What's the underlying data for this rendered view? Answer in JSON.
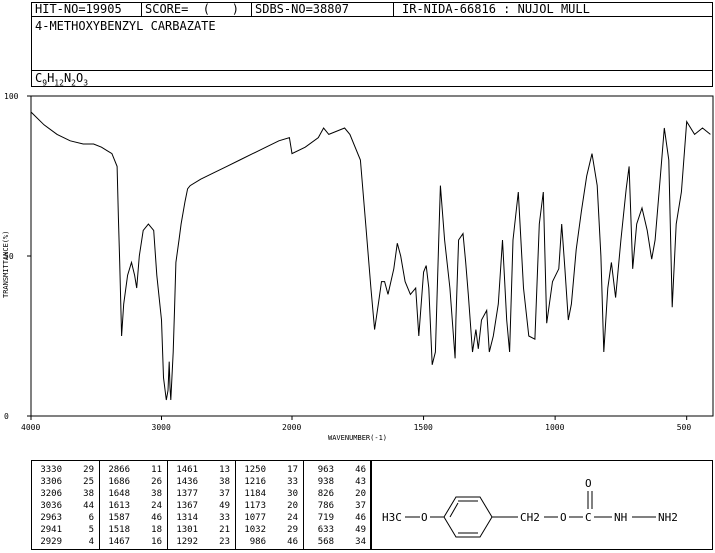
{
  "header": {
    "hit_no": "HIT-NO=19905",
    "score": "SCORE=  (   )",
    "sdbs_no": "SDBS-NO=38807",
    "ir_info": "IR-NIDA-66816 : NUJOL MULL",
    "compound_name": "4-METHOXYBENZYL CARBAZATE",
    "formula": {
      "c": "C",
      "c_n": "9",
      "h": "H",
      "h_n": "12",
      "n": "N",
      "n_n": "2",
      "o": "O",
      "o_n": "3"
    }
  },
  "chart_data": {
    "type": "line",
    "title": "",
    "xlabel": "WAVENUMBER(-1)",
    "ylabel": "TRANSMITTANCE(%)",
    "xlim": [
      4000,
      400
    ],
    "ylim": [
      0,
      100
    ],
    "x_reversed": true,
    "x_ticks": [
      4000,
      3000,
      2000,
      1500,
      1000,
      500
    ],
    "y_ticks": [
      0,
      50,
      100
    ],
    "grid": false,
    "legend": "none",
    "series": [
      {
        "x": [
          4000,
          3900,
          3800,
          3700,
          3600,
          3520,
          3460,
          3420,
          3380,
          3340,
          3330,
          3320,
          3306,
          3290,
          3260,
          3230,
          3206,
          3190,
          3170,
          3140,
          3100,
          3060,
          3036,
          3000,
          2985,
          2963,
          2950,
          2941,
          2935,
          2929,
          2910,
          2900,
          2890,
          2866,
          2850,
          2820,
          2800,
          2780,
          2700,
          2600,
          2500,
          2400,
          2300,
          2200,
          2100,
          2020,
          2000,
          1950,
          1900,
          1880,
          1860,
          1800,
          1780,
          1740,
          1720,
          1700,
          1686,
          1670,
          1660,
          1648,
          1635,
          1613,
          1600,
          1587,
          1570,
          1550,
          1530,
          1518,
          1500,
          1490,
          1480,
          1467,
          1455,
          1440,
          1436,
          1420,
          1400,
          1380,
          1377,
          1367,
          1350,
          1340,
          1330,
          1314,
          1301,
          1292,
          1280,
          1260,
          1250,
          1235,
          1216,
          1200,
          1184,
          1173,
          1160,
          1140,
          1120,
          1100,
          1077,
          1060,
          1045,
          1032,
          1010,
          986,
          975,
          963,
          950,
          938,
          920,
          900,
          880,
          860,
          840,
          826,
          815,
          800,
          786,
          770,
          750,
          730,
          719,
          705,
          690,
          670,
          650,
          633,
          620,
          600,
          585,
          568,
          555,
          540,
          520,
          500,
          470,
          440,
          410
        ],
        "y": [
          95,
          91,
          88,
          86,
          85,
          85,
          84,
          83,
          82,
          78,
          62,
          48,
          25,
          35,
          44,
          48,
          44,
          40,
          50,
          58,
          60,
          58,
          44,
          30,
          12,
          5,
          8,
          17,
          9,
          5,
          20,
          34,
          48,
          55,
          60,
          67,
          71,
          72,
          74,
          76,
          78,
          80,
          82,
          84,
          86,
          87,
          82,
          84,
          87,
          90,
          88,
          90,
          88,
          80,
          60,
          40,
          27,
          36,
          42,
          42,
          38,
          46,
          54,
          50,
          42,
          38,
          40,
          25,
          45,
          47,
          40,
          16,
          20,
          62,
          72,
          55,
          40,
          18,
          30,
          55,
          57,
          48,
          38,
          20,
          27,
          21,
          30,
          33,
          20,
          25,
          35,
          55,
          30,
          20,
          55,
          70,
          40,
          25,
          24,
          60,
          70,
          29,
          42,
          46,
          60,
          46,
          30,
          35,
          52,
          64,
          75,
          82,
          72,
          50,
          20,
          40,
          48,
          37,
          55,
          71,
          78,
          46,
          60,
          65,
          58,
          49,
          55,
          75,
          90,
          80,
          34,
          60,
          70,
          92,
          88,
          90,
          88
        ]
      }
    ]
  },
  "peaks": {
    "columns": [
      [
        [
          "3330",
          "29"
        ],
        [
          "3306",
          "25"
        ],
        [
          "3206",
          "38"
        ],
        [
          "3036",
          "44"
        ],
        [
          "2963",
          "6"
        ],
        [
          "2941",
          "5"
        ],
        [
          "2929",
          "4"
        ]
      ],
      [
        [
          "2866",
          "11"
        ],
        [
          "1686",
          "26"
        ],
        [
          "1648",
          "38"
        ],
        [
          "1613",
          "24"
        ],
        [
          "1587",
          "46"
        ],
        [
          "1518",
          "18"
        ],
        [
          "1467",
          "16"
        ]
      ],
      [
        [
          "1461",
          "13"
        ],
        [
          "1436",
          "38"
        ],
        [
          "1377",
          "37"
        ],
        [
          "1367",
          "49"
        ],
        [
          "1314",
          "33"
        ],
        [
          "1301",
          "21"
        ],
        [
          "1292",
          "23"
        ]
      ],
      [
        [
          "1250",
          "17"
        ],
        [
          "1216",
          "33"
        ],
        [
          "1184",
          "30"
        ],
        [
          "1173",
          "20"
        ],
        [
          "1077",
          "24"
        ],
        [
          "1032",
          "29"
        ],
        [
          "986",
          "46"
        ]
      ],
      [
        [
          "963",
          "46"
        ],
        [
          "938",
          "43"
        ],
        [
          "826",
          "20"
        ],
        [
          "786",
          "37"
        ],
        [
          "719",
          "46"
        ],
        [
          "633",
          "49"
        ],
        [
          "568",
          "34"
        ]
      ]
    ]
  },
  "structure": {
    "left_group": "H3C",
    "o1": "O",
    "ch2": "CH2",
    "o2": "O",
    "c": "C",
    "o_carbonyl": "O",
    "nh": "NH",
    "nh2": "NH2"
  }
}
